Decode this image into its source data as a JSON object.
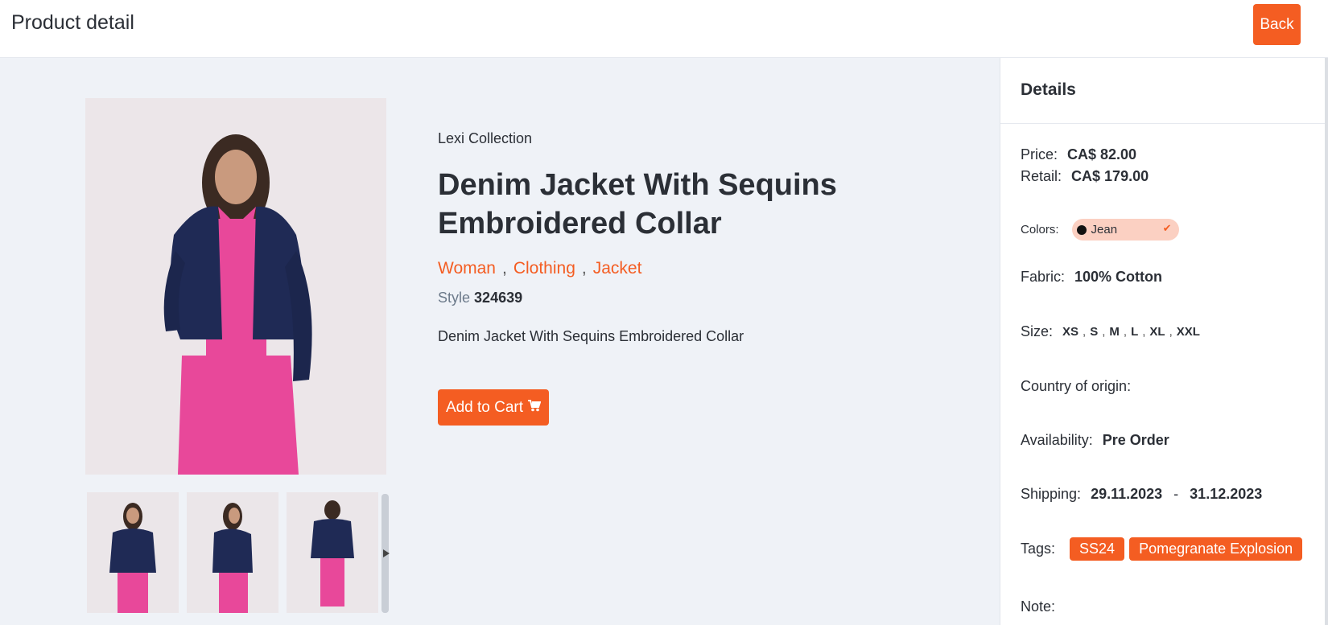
{
  "header": {
    "title": "Product detail",
    "back_label": "Back"
  },
  "product": {
    "collection": "Lexi Collection",
    "name": "Denim Jacket With Sequins Embroidered Collar",
    "categories": [
      "Woman",
      "Clothing",
      "Jacket"
    ],
    "style_label": "Style",
    "style_value": "324639",
    "description": "Denim Jacket With Sequins Embroidered Collar",
    "add_to_cart_label": "Add to Cart"
  },
  "details": {
    "heading": "Details",
    "price_label": "Price:",
    "price_value": "CA$ 82.00",
    "retail_label": "Retail:",
    "retail_value": "CA$ 179.00",
    "colors_label": "Colors:",
    "color_value": "Jean",
    "fabric_label": "Fabric:",
    "fabric_value": "100% Cotton",
    "size_label": "Size:",
    "sizes": [
      "XS",
      "S",
      "M",
      "L",
      "XL",
      "XXL"
    ],
    "country_label": "Country of origin:",
    "availability_label": "Availability:",
    "availability_value": "Pre Order",
    "shipping_label": "Shipping:",
    "shipping_from": "29.11.2023",
    "shipping_sep": "-",
    "shipping_to": "31.12.2023",
    "tags_label": "Tags:",
    "tags": [
      "SS24",
      "Pomegranate Explosion"
    ],
    "note_label": "Note:"
  },
  "colors": {
    "accent": "#f45d22",
    "background": "#eff2f7",
    "color_swatch": "#111111"
  },
  "icons": {
    "cart": "cart-icon",
    "check": "check-icon",
    "next": "chevron-right-icon"
  }
}
